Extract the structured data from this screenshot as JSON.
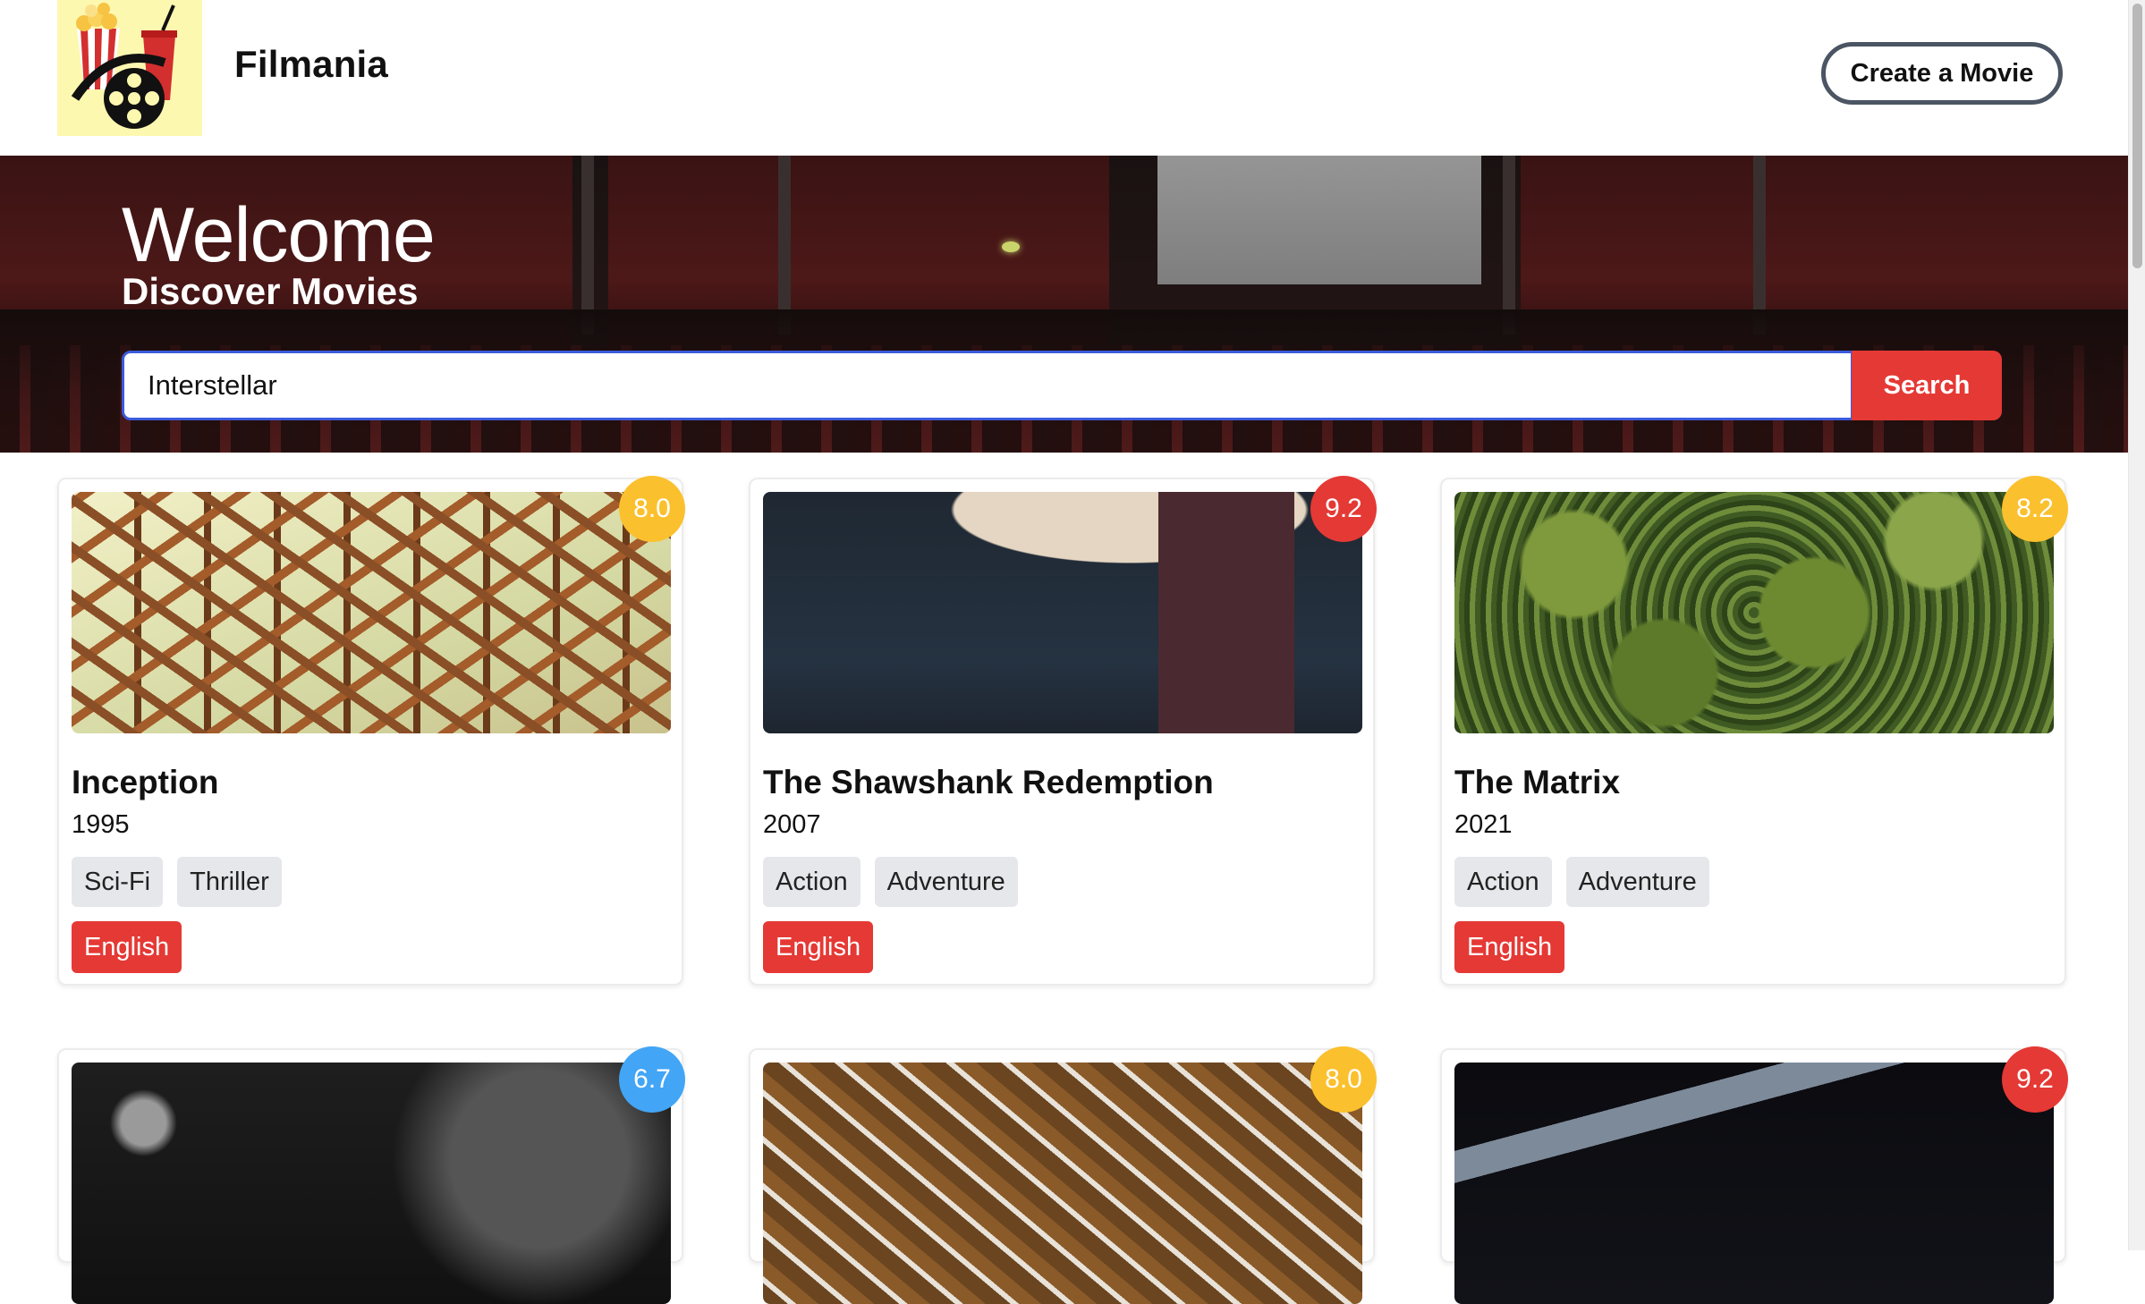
{
  "app": {
    "brand": "Filmania",
    "create_button": "Create a Movie"
  },
  "hero": {
    "title": "Welcome",
    "subtitle": "Discover Movies",
    "search_value": "Interstellar",
    "search_button": "Search"
  },
  "colors": {
    "accent_red": "#e53935",
    "rating_yellow": "#fbc02d",
    "rating_red": "#e53935",
    "rating_blue": "#42a5f5"
  },
  "movies": [
    {
      "title": "Inception",
      "year": "1995",
      "rating": "8.0",
      "rating_color": "yellow",
      "genres": [
        "Sci-Fi",
        "Thriller"
      ],
      "language": "English"
    },
    {
      "title": "The Shawshank Redemption",
      "year": "2007",
      "rating": "9.2",
      "rating_color": "red",
      "genres": [
        "Action",
        "Adventure"
      ],
      "language": "English"
    },
    {
      "title": "The Matrix",
      "year": "2021",
      "rating": "8.2",
      "rating_color": "yellow",
      "genres": [
        "Action",
        "Adventure"
      ],
      "language": "English"
    },
    {
      "title": "",
      "year": "",
      "rating": "6.7",
      "rating_color": "blue",
      "genres": [],
      "language": ""
    },
    {
      "title": "",
      "year": "",
      "rating": "8.0",
      "rating_color": "yellow",
      "genres": [],
      "language": ""
    },
    {
      "title": "",
      "year": "",
      "rating": "9.2",
      "rating_color": "red",
      "genres": [],
      "language": ""
    }
  ]
}
